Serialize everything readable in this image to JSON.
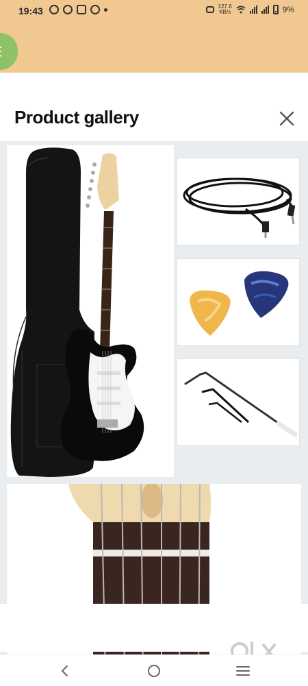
{
  "status_bar": {
    "time": "19:43",
    "network_speed_value": "127.6",
    "network_speed_unit": "KB/s",
    "battery": "9%"
  },
  "sheet": {
    "title": "Product gallery"
  },
  "images": {
    "main": "guitar-with-gig-bag",
    "thumb1": "instrument-cable",
    "thumb2": "guitar-picks",
    "thumb3": "tremolo-arm-and-allen-keys",
    "bottom": "guitar-headstock-fretboard-closeup"
  },
  "watermark": "OLX",
  "colors": {
    "top_band": "#f0c890",
    "gallery_bg": "#e9edef",
    "pick_yellow": "#f0b64a",
    "pick_blue": "#27357a",
    "green_tab": "#8fc266"
  }
}
